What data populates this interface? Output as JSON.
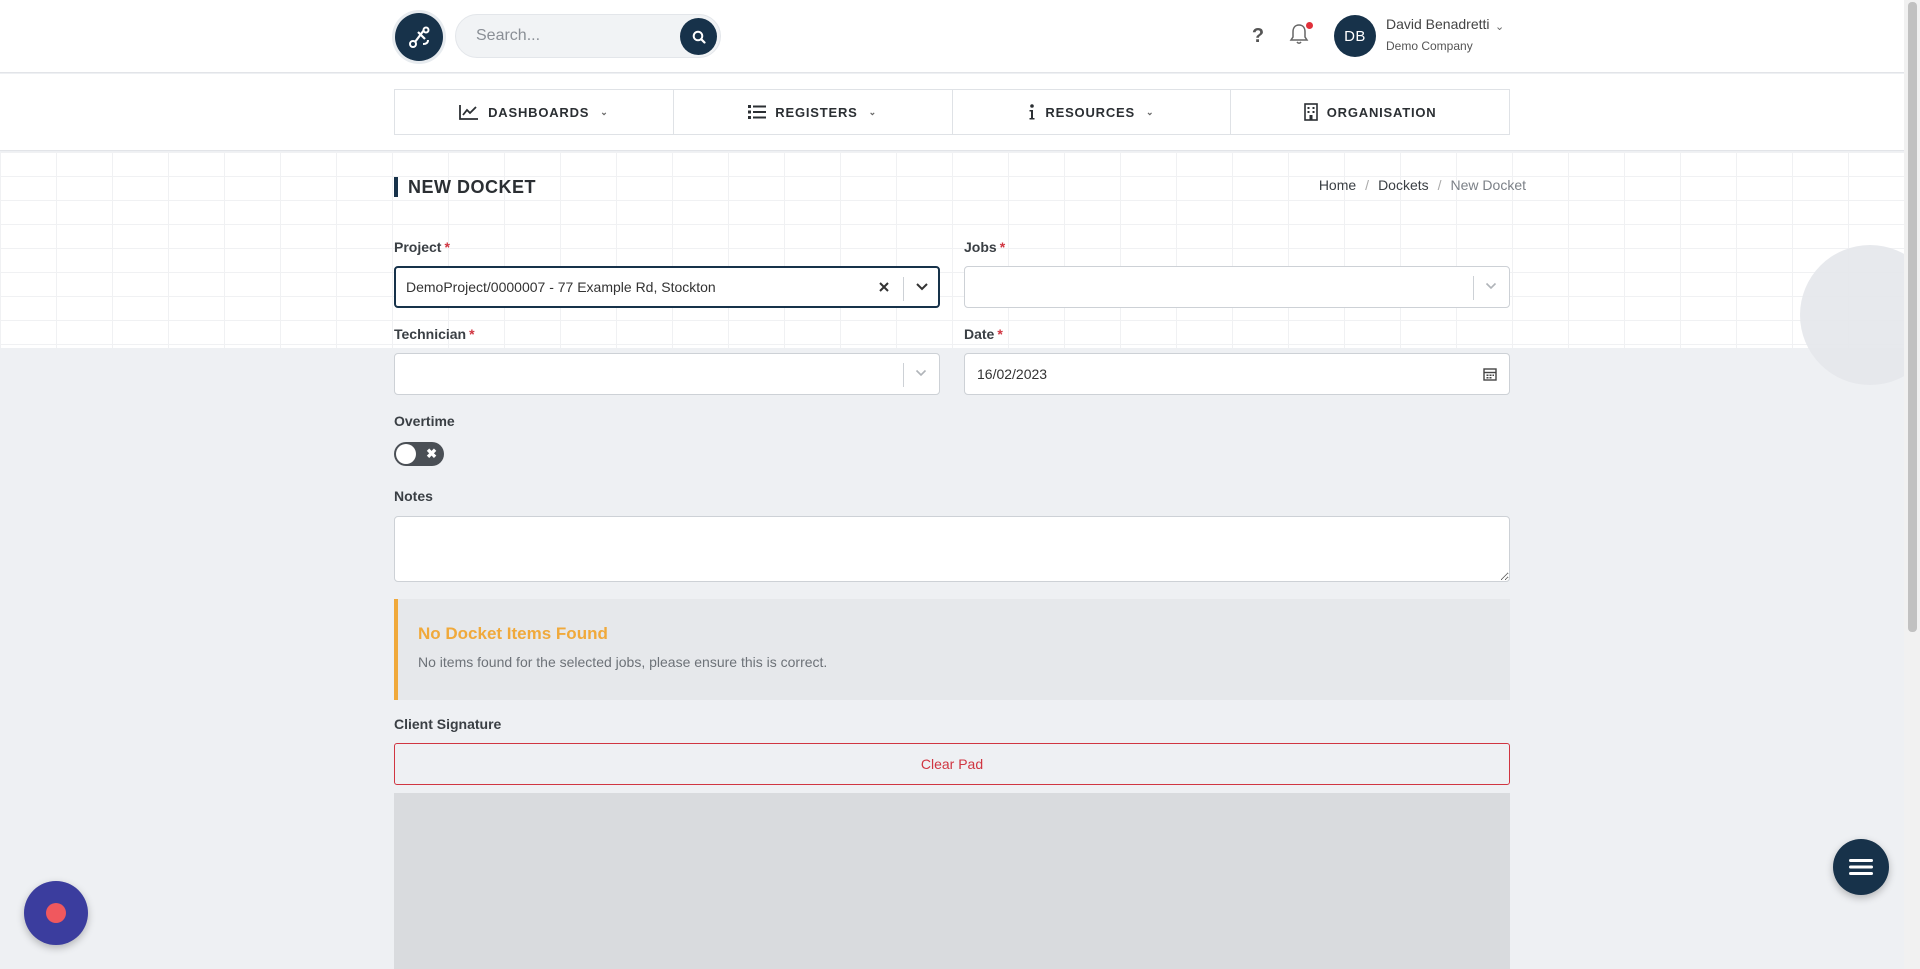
{
  "header": {
    "search_placeholder": "Search...",
    "help_label": "?",
    "user": {
      "initials": "DB",
      "name": "David Benadretti",
      "company": "Demo Company"
    }
  },
  "nav": {
    "items": [
      {
        "label": "DASHBOARDS",
        "icon": "chart-line-icon",
        "has_dropdown": true
      },
      {
        "label": "REGISTERS",
        "icon": "list-icon",
        "has_dropdown": true
      },
      {
        "label": "RESOURCES",
        "icon": "info-icon",
        "has_dropdown": true
      },
      {
        "label": "ORGANISATION",
        "icon": "building-icon",
        "has_dropdown": false
      }
    ]
  },
  "page": {
    "title": "NEW DOCKET",
    "breadcrumb": [
      "Home",
      "Dockets",
      "New Docket"
    ]
  },
  "form": {
    "project": {
      "label": "Project",
      "required": "*",
      "value": "DemoProject/0000007 - 77 Example Rd, Stockton"
    },
    "jobs": {
      "label": "Jobs",
      "required": "*",
      "value": ""
    },
    "technician": {
      "label": "Technician",
      "required": "*",
      "value": ""
    },
    "date": {
      "label": "Date",
      "required": "*",
      "value": "16/02/2023"
    },
    "overtime": {
      "label": "Overtime",
      "value": false
    },
    "notes": {
      "label": "Notes",
      "value": ""
    }
  },
  "alert": {
    "title": "No Docket Items Found",
    "message": "No items found for the selected jobs, please ensure this is correct."
  },
  "signature": {
    "label": "Client Signature",
    "clear_button": "Clear Pad"
  },
  "colors": {
    "primary": "#17324a",
    "danger": "#d03541",
    "warning": "#f0a93b",
    "record_button": "#3b3d9e"
  }
}
